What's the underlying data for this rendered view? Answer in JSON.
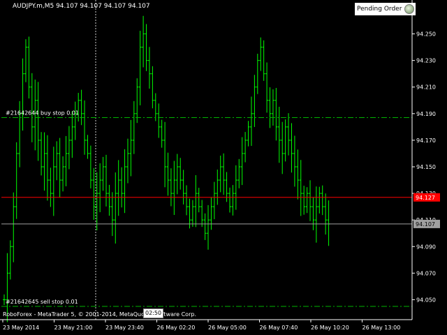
{
  "header": {
    "symbol_line": "AUDJPY.m,M5  94.107 94.107 94.107 94.107"
  },
  "pending_order_button": {
    "label": "Pending Order",
    "icon": "coin-stack-icon"
  },
  "footer": {
    "copyright": "RoboForex - MetaTrader 5, © 2001-2014, MetaQuotes Software Corp.",
    "crosshair_time_label": "02:50"
  },
  "colors": {
    "background": "#000000",
    "bars": "#00ff00",
    "grid": "#606060",
    "order_line": "#00b400",
    "bid_line": "#a0a0a0",
    "ask_line": "#ff0000",
    "crosshair": "#d0d0d0"
  },
  "chart_data": {
    "type": "ohlc",
    "symbol": "AUDJPY.m",
    "timeframe": "M5",
    "yrange": [
      94.035,
      94.265
    ],
    "y_ticks": [
      "94.250",
      "94.230",
      "94.210",
      "94.190",
      "94.170",
      "94.150",
      "94.130",
      "94.110",
      "94.090",
      "94.070",
      "94.050"
    ],
    "x_ticks": [
      "23 May 2014",
      "23 May 21:00",
      "23 May 23:40",
      "26 May 02:20",
      "26 May 05:00",
      "26 May 07:40",
      "26 May 10:20",
      "26 May 13:00"
    ],
    "bid_price": "94.107",
    "ask_price": "94.127",
    "orders": [
      {
        "label": "#21642644 buy stop 0.01",
        "price": 94.187
      },
      {
        "label": "#21642645 sell stop 0.01",
        "price": 94.045
      }
    ],
    "closes": [
      94.05,
      94.07,
      94.09,
      94.12,
      94.16,
      94.19,
      94.22,
      94.24,
      94.21,
      94.18,
      94.2,
      94.17,
      94.15,
      94.16,
      94.14,
      94.13,
      94.15,
      94.16,
      94.14,
      94.15,
      94.16,
      94.17,
      94.18,
      94.19,
      94.2,
      94.19,
      94.17,
      94.16,
      94.14,
      94.12,
      94.13,
      94.14,
      94.15,
      94.13,
      94.12,
      94.11,
      94.13,
      94.14,
      94.13,
      94.15,
      94.16,
      94.17,
      94.19,
      94.21,
      94.24,
      94.25,
      94.23,
      94.22,
      94.2,
      94.19,
      94.18,
      94.17,
      94.15,
      94.14,
      94.13,
      94.14,
      94.15,
      94.14,
      94.13,
      94.12,
      94.11,
      94.12,
      94.13,
      94.12,
      94.11,
      94.1,
      94.11,
      94.12,
      94.13,
      94.14,
      94.15,
      94.14,
      94.13,
      94.12,
      94.13,
      94.14,
      94.15,
      94.16,
      94.17,
      94.18,
      94.19,
      94.21,
      94.23,
      94.24,
      94.22,
      94.2,
      94.19,
      94.2,
      94.18,
      94.17,
      94.16,
      94.18,
      94.17,
      94.16,
      94.15,
      94.14,
      94.13,
      94.12,
      94.13,
      94.12,
      94.11,
      94.12,
      94.13,
      94.12,
      94.11,
      94.107
    ]
  }
}
